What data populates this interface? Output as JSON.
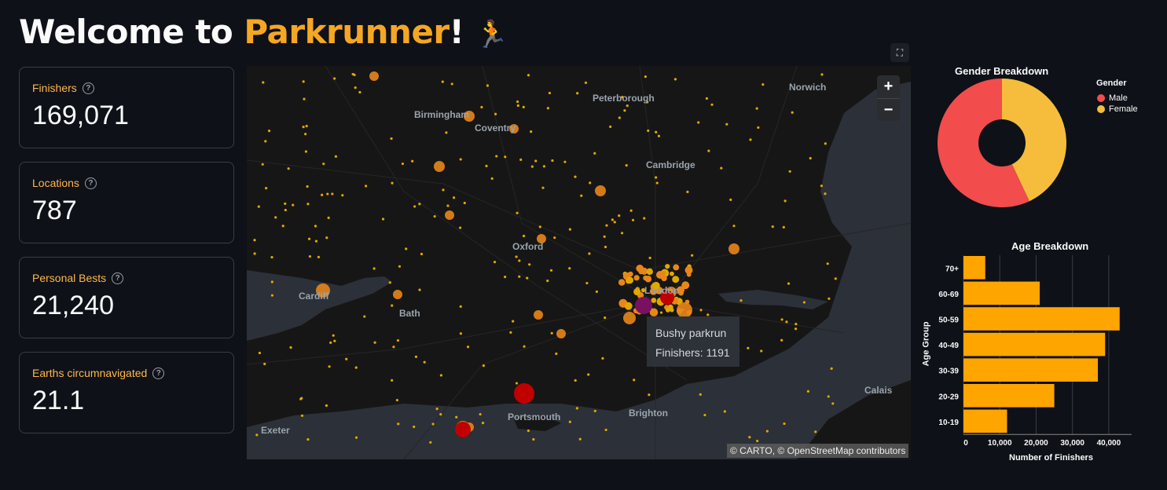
{
  "header": {
    "title_prefix": "Welcome to ",
    "title_brand": "Parkrunner",
    "title_suffix": "!",
    "title_emoji": "🏃"
  },
  "metrics": [
    {
      "label": "Finishers",
      "value": "169,071"
    },
    {
      "label": "Locations",
      "value": "787"
    },
    {
      "label": "Personal Bests",
      "value": "21,240"
    },
    {
      "label": "Earths circumnavigated",
      "value": "21.1"
    }
  ],
  "map": {
    "zoom_in": "+",
    "zoom_out": "−",
    "fullscreen_icon": "fullscreen-icon",
    "attribution": "© CARTO, © OpenStreetMap contributors",
    "cities": [
      "Norwich",
      "Peterborough",
      "Birmingham",
      "Coventry",
      "Cambridge",
      "Oxford",
      "Cardiff",
      "Bath",
      "London",
      "Portsmouth",
      "Brighton",
      "Exeter",
      "Calais"
    ],
    "tooltip": {
      "name": "Bushy parkrun",
      "finishers": "Finishers: 1191"
    },
    "colors": {
      "land": "#161616",
      "sea": "#2c3038",
      "small_marker": "#e0a800",
      "medium_marker": "#e8861a",
      "large_marker": "#c00000",
      "highlight_marker": "#7a1060"
    }
  },
  "gender_chart": {
    "title": "Gender Breakdown",
    "legend_title": "Gender",
    "chart_data": {
      "type": "pie",
      "categories": [
        "Male",
        "Female"
      ],
      "values": [
        57,
        43
      ],
      "colors": [
        "#f24c4c",
        "#f5bd3b"
      ],
      "donut": true
    }
  },
  "age_chart": {
    "title": "Age Breakdown",
    "chart_data": {
      "type": "bar",
      "orientation": "horizontal",
      "categories": [
        "70+",
        "60-69",
        "50-59",
        "40-49",
        "30-39",
        "20-29",
        "10-19"
      ],
      "values": [
        6000,
        21000,
        43000,
        39000,
        37000,
        25000,
        12000
      ],
      "xlabel": "Number of Finishers",
      "ylabel": "Age Group",
      "xlim": [
        0,
        45000
      ],
      "xticks": [
        "0",
        "10,000",
        "20,000",
        "30,000",
        "40,000"
      ],
      "color": "#ffa500"
    }
  }
}
